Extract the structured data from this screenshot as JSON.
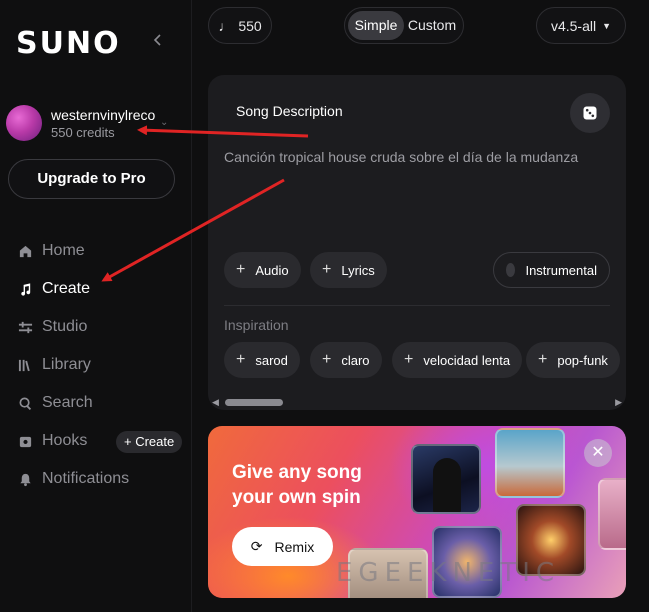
{
  "sidebar": {
    "logo": "SUNO",
    "collapse_icon": "chevron-left-icon",
    "profile": {
      "username": "westernvinylreco",
      "credits": "550 credits"
    },
    "upgrade_label": "Upgrade to Pro",
    "items": [
      {
        "label": "Home",
        "icon": "home-icon",
        "active": false
      },
      {
        "label": "Create",
        "icon": "music-note-icon",
        "active": true
      },
      {
        "label": "Studio",
        "icon": "sliders-icon",
        "active": false
      },
      {
        "label": "Library",
        "icon": "library-icon",
        "active": false
      },
      {
        "label": "Search",
        "icon": "search-icon",
        "active": false
      },
      {
        "label": "Hooks",
        "icon": "hooks-icon",
        "active": false
      },
      {
        "label": "Notifications",
        "icon": "bell-icon",
        "active": false
      }
    ],
    "hooks_create_label": "+ Create"
  },
  "topbar": {
    "credits": "550",
    "mode_simple": "Simple",
    "mode_custom": "Custom",
    "mode_selected": "Simple",
    "version": "v4.5-all"
  },
  "panel": {
    "song_description_label": "Song Description",
    "description_text": "Canción tropical house cruda sobre el día de la mudanza",
    "audio_label": "Audio",
    "lyrics_label": "Lyrics",
    "instrumental_label": "Instrumental",
    "inspiration_label": "Inspiration",
    "inspiration_tags": [
      "sarod",
      "claro",
      "velocidad lenta",
      "pop-funk"
    ]
  },
  "banner": {
    "title": "Give any song your own spin",
    "remix_label": "Remix",
    "watermark": "EGEEKNETIC"
  },
  "colors": {
    "background": "#0f0f10",
    "panel": "#1c1c1f",
    "annotation_arrow": "#e02424"
  }
}
